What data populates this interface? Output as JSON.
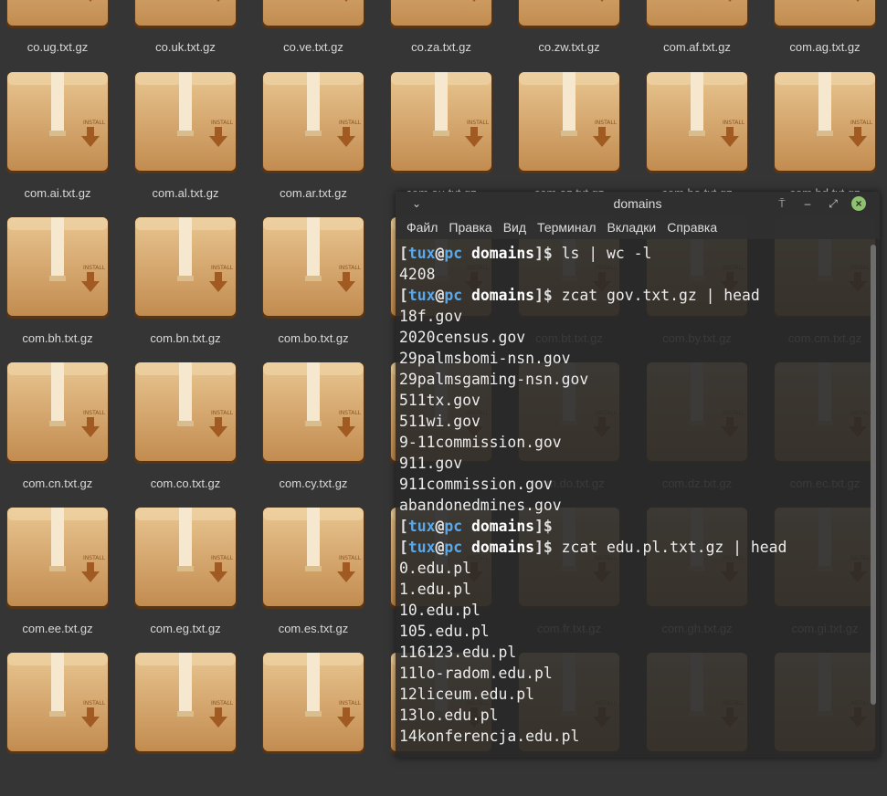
{
  "desktop": {
    "files": [
      [
        "co.ug.txt.gz",
        "co.uk.txt.gz",
        "co.ve.txt.gz",
        "co.za.txt.gz",
        "co.zw.txt.gz",
        "com.af.txt.gz",
        "com.ag.txt.gz"
      ],
      [
        "com.ai.txt.gz",
        "com.al.txt.gz",
        "com.ar.txt.gz",
        "com.au.txt.gz",
        "com.az.txt.gz",
        "com.ba.txt.gz",
        "com.bd.txt.gz"
      ],
      [
        "com.bh.txt.gz",
        "com.bn.txt.gz",
        "com.bo.txt.gz",
        "",
        "com.bt.txt.gz",
        "com.by.txt.gz",
        "com.cm.txt.gz"
      ],
      [
        "com.cn.txt.gz",
        "com.co.txt.gz",
        "com.cy.txt.gz",
        "",
        "com.do.txt.gz",
        "com.dz.txt.gz",
        "com.ec.txt.gz"
      ],
      [
        "com.ee.txt.gz",
        "com.eg.txt.gz",
        "com.es.txt.gz",
        "",
        "com.fr.txt.gz",
        "com.gh.txt.gz",
        "com.gi.txt.gz"
      ],
      [
        "",
        "",
        "",
        "",
        "",
        "",
        ""
      ]
    ],
    "package_label": "INSTALL"
  },
  "terminal": {
    "title": "domains",
    "menu": [
      "Файл",
      "Правка",
      "Вид",
      "Терминал",
      "Вкладки",
      "Справка"
    ],
    "prompt": {
      "open": "[",
      "user": "tux",
      "at": "@",
      "host": "pc",
      "dir": "domains",
      "close": "]$"
    },
    "lines": [
      {
        "prompt": true,
        "cmd": "ls | wc -l"
      },
      {
        "text": "4208"
      },
      {
        "prompt": true,
        "cmd": "zcat gov.txt.gz | head"
      },
      {
        "text": "18f.gov"
      },
      {
        "text": "2020census.gov"
      },
      {
        "text": "29palmsbomi-nsn.gov"
      },
      {
        "text": "29palmsgaming-nsn.gov"
      },
      {
        "text": "511tx.gov"
      },
      {
        "text": "511wi.gov"
      },
      {
        "text": "9-11commission.gov"
      },
      {
        "text": "911.gov"
      },
      {
        "text": "911commission.gov"
      },
      {
        "text": "abandonedmines.gov"
      },
      {
        "prompt": true,
        "cmd": ""
      },
      {
        "prompt": true,
        "cmd": "zcat edu.pl.txt.gz | head"
      },
      {
        "text": "0.edu.pl"
      },
      {
        "text": "1.edu.pl"
      },
      {
        "text": "10.edu.pl"
      },
      {
        "text": "105.edu.pl"
      },
      {
        "text": "116123.edu.pl"
      },
      {
        "text": "11lo-radom.edu.pl"
      },
      {
        "text": "12liceum.edu.pl"
      },
      {
        "text": "13lo.edu.pl"
      },
      {
        "text": "14konferencja.edu.pl"
      }
    ]
  },
  "colors": {
    "desktop_bg": "#353535",
    "prompt_user": "#5aa8e8",
    "close_button": "#8dc26e"
  }
}
